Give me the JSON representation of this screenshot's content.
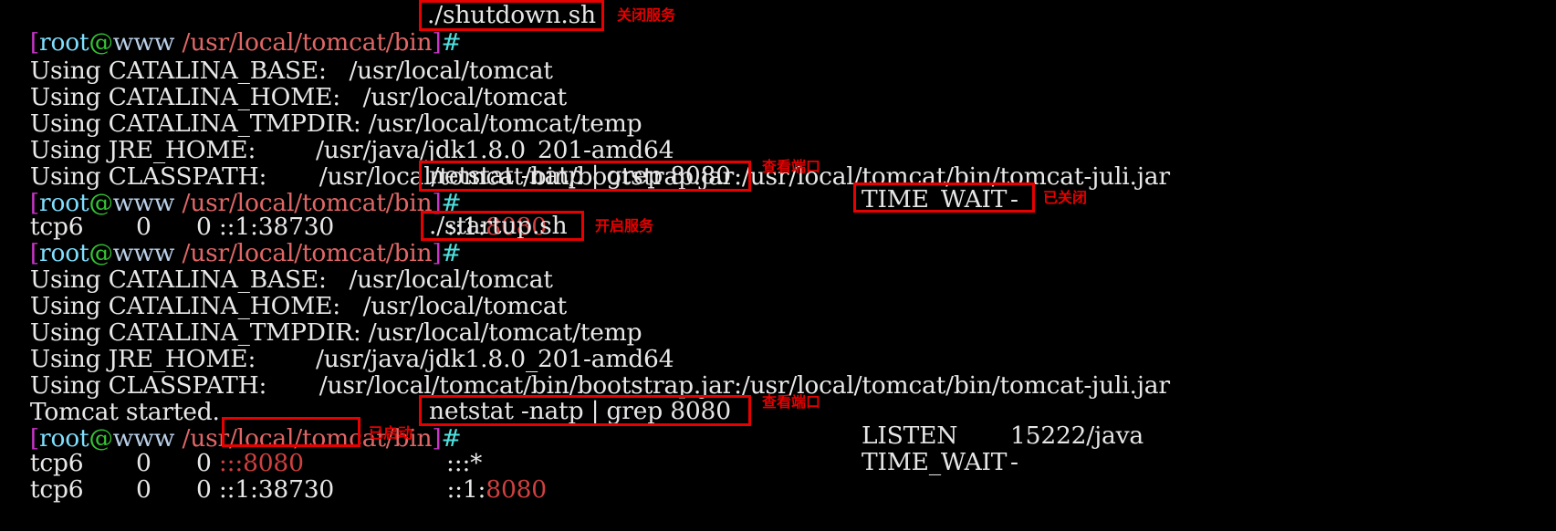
{
  "terminal": {
    "background_color": "#000000",
    "default_text_color": "#e6e6e6",
    "prompt": {
      "open_bracket": "[",
      "user": "root",
      "at": "@",
      "host": "www",
      "space": " ",
      "path": "/usr/local/tomcat/bin",
      "close_bracket": "]",
      "hash": "#",
      "colors": {
        "bracket": "#c836c8",
        "user": "#7fdfff",
        "at": "#34c634",
        "host": "#b9cfe8",
        "path": "#e06666",
        "hash": "#4fe0e0"
      }
    },
    "commands": {
      "shutdown": "./shutdown.sh",
      "startup": "./startup.sh",
      "netstat": "netstat -natp | grep 8080"
    },
    "output_lines": {
      "catalina_base_label": "Using CATALINA_BASE:   ",
      "catalina_base_value": "/usr/local/tomcat",
      "catalina_home_label": "Using CATALINA_HOME:   ",
      "catalina_home_value": "/usr/local/tomcat",
      "catalina_tmpdir_label": "Using CATALINA_TMPDIR: ",
      "catalina_tmpdir_value": "/usr/local/tomcat/temp",
      "jre_home_label": "Using JRE_HOME:        ",
      "jre_home_value": "/usr/java/jdk1.8.0_201-amd64",
      "classpath_label": "Using CLASSPATH:       ",
      "classpath_value": "/usr/local/tomcat/bin/bootstrap.jar:/usr/local/tomcat/bin/tomcat-juli.jar",
      "tomcat_started": "Tomcat started."
    },
    "netstat_rows": {
      "row1": {
        "proto": "tcp6",
        "recvq": "0",
        "sendq": "0",
        "local_address_prefix": "::1:38730",
        "foreign_address_prefix": "::1:",
        "foreign_address_port": "8080",
        "state": "TIME_WAIT",
        "pid_program": "-"
      },
      "row2": {
        "proto": "tcp6",
        "recvq": "0",
        "sendq": "0",
        "local_address_prefix": ":::",
        "local_address_port": "8080",
        "foreign_address": ":::*",
        "state": "LISTEN",
        "pid_program": "15222/java"
      },
      "row3": {
        "proto": "tcp6",
        "recvq": "0",
        "sendq": "0",
        "local_address_prefix": "::1:38730",
        "foreign_address_prefix": "::1:",
        "foreign_address_port": "8080",
        "state": "TIME_WAIT",
        "pid_program": "-"
      }
    }
  },
  "annotations": {
    "shutdown_note": "关闭服务",
    "netstat_note_1": "查看端口",
    "closed_note": "已关闭",
    "startup_note": "开启服务",
    "netstat_note_2": "查看端口",
    "started_note": "已启动",
    "color": "#e60000"
  }
}
